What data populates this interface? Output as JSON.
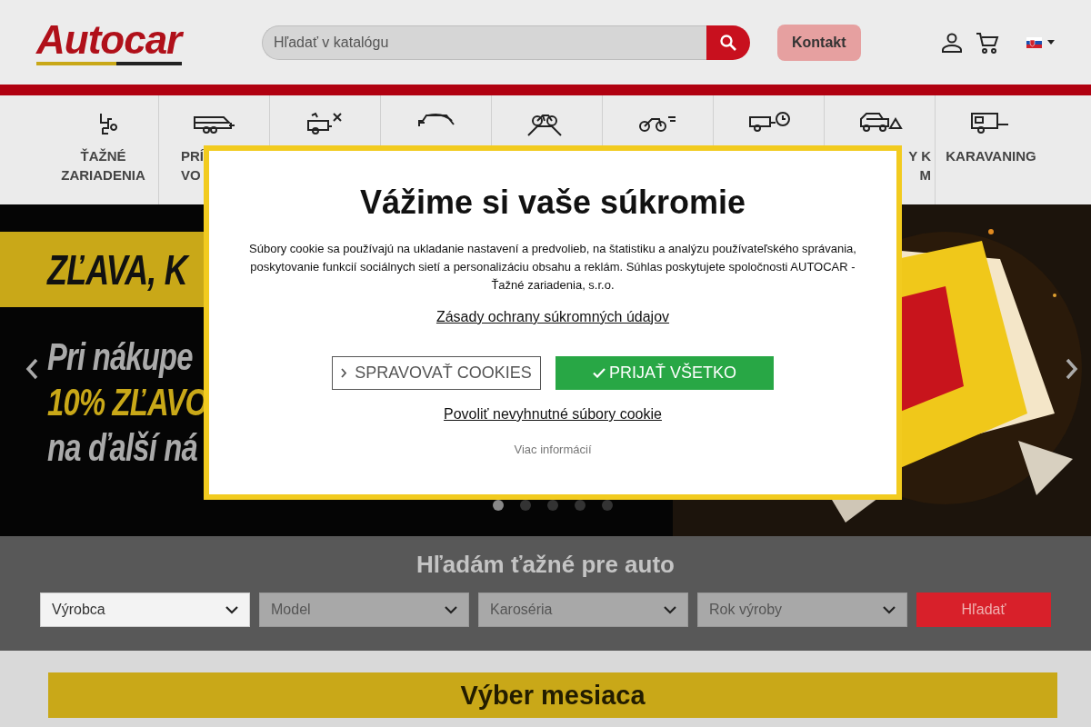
{
  "header": {
    "logo": "Autocar",
    "search": {
      "placeholder": "Hľadať v katalógu"
    },
    "contact_button": "Kontakt"
  },
  "nav": {
    "items": [
      {
        "kind": "category",
        "label_lines": [
          "ŤAŽNÉ",
          "ZARIADENIA"
        ]
      },
      {
        "kind": "category",
        "label_lines": [
          "PRÍ",
          "VO"
        ]
      },
      {
        "kind": "category"
      },
      {
        "kind": "category"
      },
      {
        "kind": "category"
      },
      {
        "kind": "category"
      },
      {
        "kind": "category"
      },
      {
        "kind": "category",
        "label_lines": [
          "Y K",
          "M"
        ]
      },
      {
        "kind": "category",
        "label_lines": [
          "KARAVANING"
        ]
      }
    ]
  },
  "banner": {
    "headline": "ZĽAVA, K",
    "lines": [
      {
        "text": "Pri nákupe",
        "highlight": false
      },
      {
        "text": "10% ZĽAVO",
        "highlight": true
      },
      {
        "text": "na ďalší ná",
        "highlight": false
      }
    ],
    "dots": [
      {
        "selected": true
      },
      {
        "selected": false
      },
      {
        "selected": false
      },
      {
        "selected": false
      },
      {
        "selected": false
      }
    ]
  },
  "vehicle_search": {
    "title": "Hľadám ťažné pre auto",
    "selects": [
      {
        "label": "Výrobca",
        "disabled": false
      },
      {
        "label": "Model",
        "disabled": true
      },
      {
        "label": "Karoséria",
        "disabled": true
      },
      {
        "label": "Rok výroby",
        "disabled": true
      }
    ],
    "button": "Hľadať"
  },
  "featured": {
    "title": "Výber mesiaca"
  },
  "cookie_dialog": {
    "title": "Vážime si vaše súkromie",
    "text": "Súbory cookie sa používajú na ukladanie nastavení a predvolieb, na štatistiku a analýzu používateľského správania, poskytovanie funkcií sociálnych sietí a personalizáciu obsahu a reklám. Súhlas poskytujete spoločnosti AUTOCAR - Ťažné zariadenia, s.r.o.",
    "privacy_link": "Zásady ochrany súkromných údajov",
    "manage_button": "SPRAVOVAŤ COOKIES",
    "accept_button": "PRIJAŤ VŠETKO",
    "necessary_link": "Povoliť nevyhnutné súbory cookie",
    "more_info": "Viac informácií"
  }
}
